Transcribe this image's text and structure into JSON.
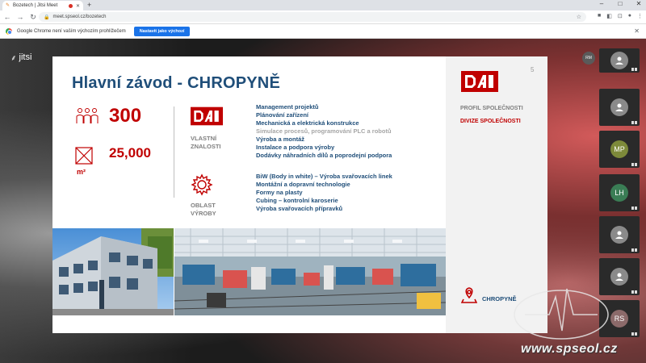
{
  "browser": {
    "tab_title": "Bozetech | Jitsi Meet",
    "new_tab": "+",
    "url": "meet.spseol.cz/bozetech",
    "infobar_message": "Google Chrome není vaším výchozím prohlížečem",
    "infobar_button": "Nastavit jako výchozí",
    "window_controls": [
      "–",
      "□",
      "✕"
    ]
  },
  "meeting": {
    "app_name": "jitsi",
    "self_initials": "RM",
    "participants": [
      {
        "initials": "",
        "kind": "user-icon"
      },
      {
        "initials": "",
        "kind": "user-icon"
      },
      {
        "initials": "MP",
        "kind": "initials",
        "color": "#7d8a3a"
      },
      {
        "initials": "LH",
        "kind": "initials",
        "color": "#3a7d55"
      },
      {
        "initials": "",
        "kind": "user-icon"
      },
      {
        "initials": "",
        "kind": "user-icon"
      },
      {
        "initials": "RS",
        "kind": "initials",
        "color": "#8c6a6a"
      }
    ]
  },
  "slide": {
    "title": "Hlavní závod - CHROPYNĚ",
    "page_number": "5",
    "stat_employees": "300",
    "stat_area": "25,000",
    "area_unit": "m²",
    "section1_label_line1": "VLASTNÍ",
    "section1_label_line2": "ZNALOSTI",
    "section2_label_line1": "OBLAST",
    "section2_label_line2": "VÝROBY",
    "knowledge_items": [
      "Management projektů",
      "Plánování zařízení",
      "Mechanická a elektrická konstrukce",
      "Simulace procesů, programování PLC a robotů",
      "Výroba a montáž",
      "Instalace a podpora výroby",
      "Dodávky náhradních dílů a poprodejní podpora"
    ],
    "production_items": [
      "BiW (Body in white) – Výroba svařovacích linek",
      "Montážní a dopravní technologie",
      "Formy na plasty",
      "Cubing – kontrolní karoserie",
      "Výroba svařovacích přípravků"
    ],
    "profile_label": "PROFIL SPOLEČNOSTI",
    "division_label": "DIVIZE SPOLEČNOSTI",
    "location_label": "CHROPYNĚ",
    "brand_red": "#c00000",
    "brand_blue": "#1f4e79"
  },
  "watermark": {
    "text": "www.spseol.cz"
  }
}
